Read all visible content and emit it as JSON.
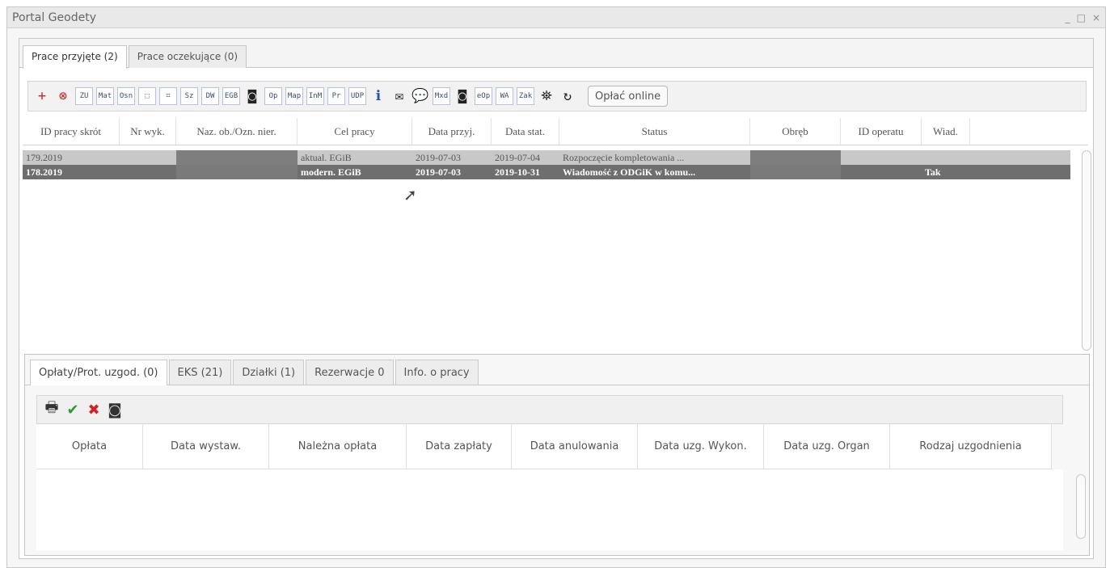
{
  "window": {
    "title": "Portal Geodety",
    "controls": [
      "_",
      "□",
      "×"
    ]
  },
  "tabs": [
    {
      "label": "Prace przyjęte (2)",
      "active": true
    },
    {
      "label": "Prace oczekujące (0)",
      "active": false
    }
  ],
  "toolbar": {
    "buttons": [
      {
        "name": "add-icon",
        "glyph": "+",
        "style": "plain red"
      },
      {
        "name": "cancel-icon",
        "glyph": "⊗",
        "style": "plain red"
      },
      {
        "name": "zu-button",
        "glyph": "ZU",
        "style": ""
      },
      {
        "name": "mat-button",
        "glyph": "Mat",
        "style": ""
      },
      {
        "name": "osn-button",
        "glyph": "Osn",
        "style": ""
      },
      {
        "name": "select-area-icon",
        "glyph": "⬚",
        "style": ""
      },
      {
        "name": "edit-area-icon",
        "glyph": "⌗",
        "style": ""
      },
      {
        "name": "sz-button",
        "glyph": "Sz",
        "style": ""
      },
      {
        "name": "dw-button",
        "glyph": "DW",
        "style": ""
      },
      {
        "name": "egb-button",
        "glyph": "EGB",
        "style": ""
      },
      {
        "name": "camera-icon",
        "glyph": "◙",
        "style": "plain black"
      },
      {
        "name": "op-button",
        "glyph": "Op",
        "style": ""
      },
      {
        "name": "map-button",
        "glyph": "Map",
        "style": ""
      },
      {
        "name": "inm-button",
        "glyph": "InM",
        "style": ""
      },
      {
        "name": "pr-button",
        "glyph": "Pr",
        "style": ""
      },
      {
        "name": "udp-button",
        "glyph": "UDP",
        "style": ""
      },
      {
        "name": "info-icon",
        "glyph": "ℹ",
        "style": "plain blue"
      },
      {
        "name": "mail-icon",
        "glyph": "✉",
        "style": "plain black"
      },
      {
        "name": "chat-icon",
        "glyph": "💬",
        "style": "plain blue"
      },
      {
        "name": "mxd-button",
        "glyph": "Mxd",
        "style": ""
      },
      {
        "name": "photo-icon",
        "glyph": "◙",
        "style": "plain black"
      },
      {
        "name": "eop-button",
        "glyph": "eOp",
        "style": ""
      },
      {
        "name": "wa-button",
        "glyph": "WA",
        "style": ""
      },
      {
        "name": "zak-button",
        "glyph": "Zak",
        "style": ""
      },
      {
        "name": "binoculars-icon",
        "glyph": "⛯",
        "style": "plain black"
      },
      {
        "name": "refresh-icon",
        "glyph": "↻",
        "style": "plain black"
      }
    ],
    "pay_online_label": "Opłać online"
  },
  "grid": {
    "columns": [
      "ID pracy skrót",
      "Nr wyk.",
      "Naz. ob./Ozn. nier.",
      "Cel pracy",
      "Data przyj.",
      "Data stat.",
      "Status",
      "Obręb",
      "ID operatu",
      "Wiad."
    ],
    "rows": [
      {
        "id": "179.2019",
        "nr": "",
        "naz": "",
        "cel": "aktual. EGiB",
        "przyj": "2019-07-03",
        "stat": "2019-07-04",
        "status": "Rozpoczęcie kompletowania ...",
        "obreb": "",
        "operat": "",
        "wiad": ""
      },
      {
        "id": "178.2019",
        "nr": "",
        "naz": "",
        "cel": "modern. EGiB",
        "przyj": "2019-07-03",
        "stat": "2019-10-31",
        "status": "Wiadomość z ODGiK w komu...",
        "obreb": "",
        "operat": "",
        "wiad": "Tak"
      }
    ]
  },
  "subtabs": [
    {
      "label": "Opłaty/Prot. uzgod. (0)",
      "active": true
    },
    {
      "label": "EKS (21)",
      "active": false
    },
    {
      "label": "Działki (1)",
      "active": false
    },
    {
      "label": "Rezerwacje 0",
      "active": false
    },
    {
      "label": "Info. o pracy",
      "active": false
    }
  ],
  "subtoolbar": {
    "print": "🖶",
    "accept": "✔",
    "reject": "✖",
    "camera": "◙"
  },
  "subgrid": {
    "columns": [
      "Opłata",
      "Data wystaw.",
      "Należna opłata",
      "Data zapłaty",
      "Data anulowania",
      "Data uzg. Wykon.",
      "Data uzg. Organ",
      "Rodzaj uzgodnienia"
    ]
  },
  "colors": {
    "selected_row": "#6e6e6e",
    "row_light": "#c8c8c8",
    "red": "#d32222",
    "green": "#2f9a2f",
    "blue": "#1e56b7"
  }
}
